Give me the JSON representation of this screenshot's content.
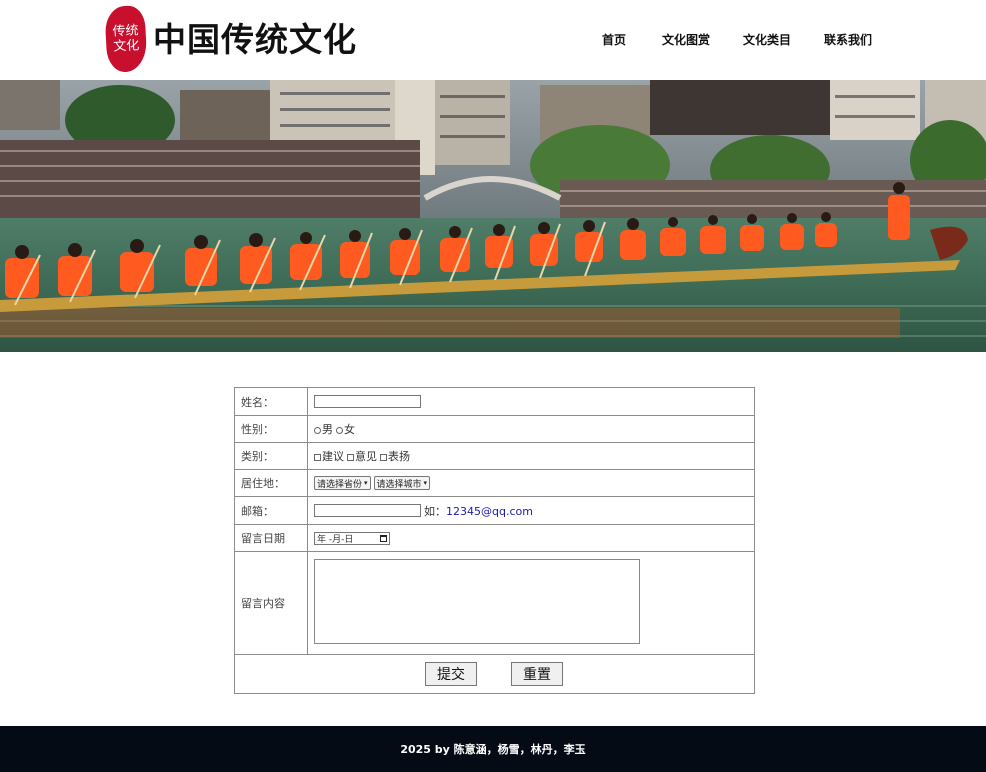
{
  "header": {
    "logo_seal_text": [
      "传统",
      "文化"
    ],
    "site_title": "中国传统文化",
    "nav": [
      {
        "label": "首页"
      },
      {
        "label": "文化图赏"
      },
      {
        "label": "文化类目"
      },
      {
        "label": "联系我们"
      }
    ]
  },
  "banner": {
    "description_hidden": "",
    "accent_color": "#ff5a1f",
    "water_color": "#3e6b55"
  },
  "form": {
    "name": {
      "label": "姓名：",
      "value": ""
    },
    "gender": {
      "label": "性别：",
      "options": [
        "男",
        "女"
      ]
    },
    "category": {
      "label": "类别：",
      "options": [
        "建议",
        "意见",
        "表扬"
      ]
    },
    "residence": {
      "label": "居住地：",
      "province_placeholder": "请选择省份",
      "city_placeholder": "请选择城市"
    },
    "email": {
      "label": "邮箱：",
      "value": "",
      "hint_prefix": "如：",
      "hint_example": "12345@qq.com"
    },
    "date": {
      "label": "留言日期",
      "placeholder": "年 -月-日"
    },
    "message": {
      "label": "留言内容",
      "value": ""
    },
    "submit_label": "提交",
    "reset_label": "重置"
  },
  "footer": {
    "text": "2025 by 陈意涵，杨雪，林丹，李玉"
  },
  "colors": {
    "brand_red": "#c8102e",
    "footer_bg": "#050b14",
    "link_blue": "#1a1ab3"
  }
}
